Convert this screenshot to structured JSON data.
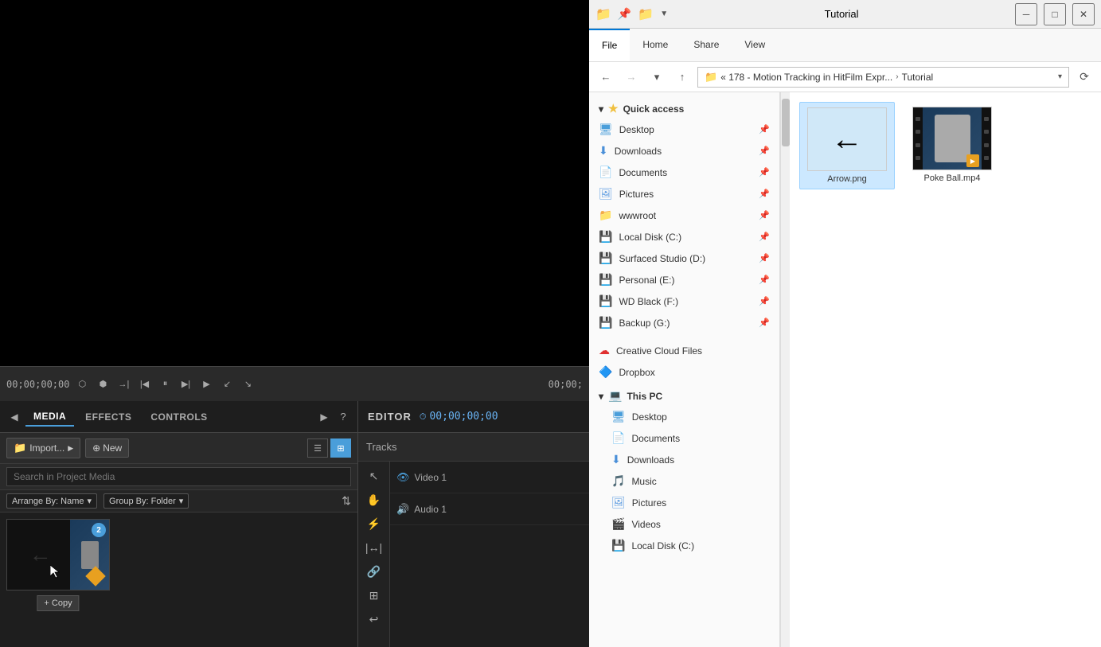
{
  "app": {
    "title": "Tutorial"
  },
  "left_panel": {
    "preview": {
      "background": "#000"
    },
    "transport": {
      "time_left": "00;00;00;00",
      "time_right": "00;00;"
    },
    "tabs": {
      "media_label": "MEDIA",
      "effects_label": "EFFECTS",
      "controls_label": "CONTROLS"
    },
    "media": {
      "import_label": "Import...",
      "new_label": "New",
      "search_placeholder": "Search in Project Media",
      "arrange_label": "Arrange By: Name",
      "group_label": "Group By: Folder",
      "thumb_badge": "2",
      "copy_tooltip": "+ Copy"
    },
    "editor": {
      "title": "EDITOR",
      "timecode": "00;00;00;00",
      "tracks_label": "Tracks",
      "video1_label": "Video 1",
      "audio1_label": "Audio 1"
    }
  },
  "explorer": {
    "title": "Tutorial",
    "ribbon_tabs": [
      "File",
      "Home",
      "Share",
      "View"
    ],
    "ribbon_active": "File",
    "address": {
      "path_main": "« 178 - Motion Tracking in HitFilm Expr...",
      "path_sub": "Tutorial"
    },
    "sidebar": {
      "quick_access_label": "Quick access",
      "items": [
        {
          "label": "Desktop",
          "icon": "desktop",
          "pinned": true
        },
        {
          "label": "Downloads",
          "icon": "downloads",
          "pinned": true
        },
        {
          "label": "Documents",
          "icon": "docs",
          "pinned": true
        },
        {
          "label": "Pictures",
          "icon": "pics",
          "pinned": true
        },
        {
          "label": "wwwroot",
          "icon": "folder_yellow",
          "pinned": true
        },
        {
          "label": "Local Disk (C:)",
          "icon": "drive",
          "pinned": true
        },
        {
          "label": "Surfaced Studio (D:)",
          "icon": "drive",
          "pinned": true
        },
        {
          "label": "Personal (E:)",
          "icon": "drive",
          "pinned": true
        },
        {
          "label": "WD Black (F:)",
          "icon": "drive",
          "pinned": true
        },
        {
          "label": "Backup (G:)",
          "icon": "drive",
          "pinned": true
        },
        {
          "label": "Creative Cloud Files",
          "icon": "cloud",
          "pinned": false
        },
        {
          "label": "Dropbox",
          "icon": "dropbox",
          "pinned": false
        },
        {
          "label": "This PC",
          "icon": "pc",
          "pinned": false
        }
      ],
      "this_pc_items": [
        {
          "label": "Desktop",
          "icon": "desktop"
        },
        {
          "label": "Documents",
          "icon": "docs"
        },
        {
          "label": "Downloads",
          "icon": "downloads"
        },
        {
          "label": "Music",
          "icon": "music"
        },
        {
          "label": "Pictures",
          "icon": "pics"
        },
        {
          "label": "Videos",
          "icon": "videos"
        },
        {
          "label": "Local Disk (C:)",
          "icon": "drive"
        }
      ]
    },
    "files": [
      {
        "name": "Arrow.png",
        "type": "png",
        "selected": true
      },
      {
        "name": "Poke Ball.mp4",
        "type": "mp4",
        "selected": false
      }
    ]
  }
}
